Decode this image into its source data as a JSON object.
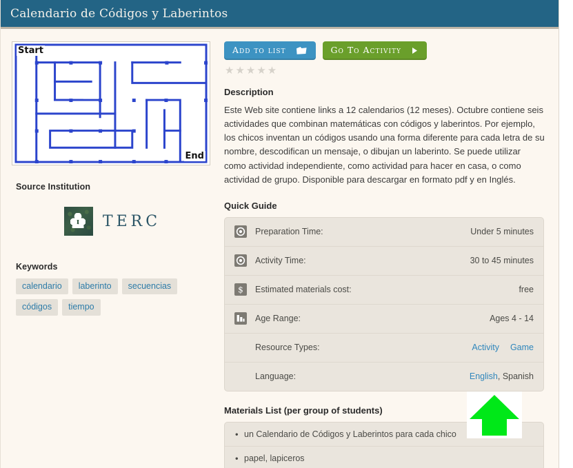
{
  "header": {
    "title": "Calendario de Códigos y Laberintos"
  },
  "thumbnail": {
    "alt_name": "maze-thumbnail",
    "start_label": "Start",
    "end_label": "End"
  },
  "sidebar": {
    "source_institution_heading": "Source Institution",
    "institution_name": "TERC",
    "keywords_heading": "Keywords",
    "keywords": [
      "calendario",
      "laberinto",
      "secuencias",
      "códigos",
      "tiempo"
    ]
  },
  "actions": {
    "add_to_list_label": "Add to list",
    "go_to_activity_label": "Go To Activity",
    "rating_stars": "★★★★★",
    "rating_filled": 0,
    "rating_max": 5
  },
  "description": {
    "heading": "Description",
    "text": "Este Web site contiene links a 12 calendarios (12 meses). Octubre contiene seis actividades que combinan matemáticas con códigos y laberintos. Por ejemplo, los chicos inventan un códigos usando una forma diferente para cada letra de su nombre, descodifican un mensaje, o dibujan un laberinto. Se puede utilizar como actividad independiente, como actividad para hacer en casa, o como actividad de grupo. Disponible para descargar en formato pdf y en Inglés."
  },
  "quick_guide": {
    "heading": "Quick Guide",
    "rows": [
      {
        "icon": "clock-icon",
        "label": "Preparation Time:",
        "value": "Under 5 minutes"
      },
      {
        "icon": "clock-icon",
        "label": "Activity Time:",
        "value": "30 to 45 minutes"
      },
      {
        "icon": "dollar-icon",
        "label": "Estimated materials cost:",
        "value": "free"
      },
      {
        "icon": "age-range-icon",
        "label": "Age Range:",
        "value": "Ages 4 - 14"
      },
      {
        "icon": "none",
        "label": "Resource Types:",
        "links": [
          "Activity",
          "Game"
        ]
      },
      {
        "icon": "none",
        "label": "Language:",
        "links": [
          "English"
        ],
        "plain_suffix": ", Spanish"
      }
    ]
  },
  "materials": {
    "heading": "Materials List (per group of students)",
    "items": [
      "un Calendario de Códigos y Laberintos para cada chico",
      "papel, lapiceros"
    ]
  },
  "cursor": {
    "name": "green-arrow-cursor",
    "color": "#00e818"
  },
  "colors": {
    "header_bar": "#236485",
    "page_background": "#fcf7f0",
    "panel_background": "#eae5dd",
    "link_blue": "#2f86bc",
    "button_blue": "#3d93c2",
    "button_green": "#6a9f2b",
    "chip_background": "#e4e0d8",
    "maze_stroke": "#2b44cc"
  }
}
